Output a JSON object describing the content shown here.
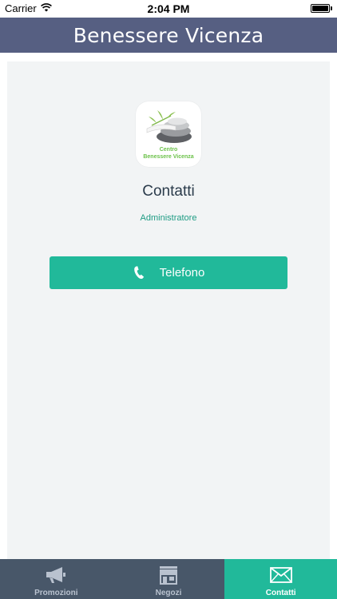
{
  "status_bar": {
    "carrier": "Carrier",
    "time": "2:04 PM"
  },
  "nav": {
    "title": "Benessere Vicenza"
  },
  "contact": {
    "logo": {
      "line1": "Centro",
      "line2": "Benessere Vicenza"
    },
    "title": "Contatti",
    "role": "Administratore",
    "phone_button_label": "Telefono"
  },
  "tabs": [
    {
      "label": "Promozioni",
      "icon": "megaphone-icon",
      "active": false
    },
    {
      "label": "Negozi",
      "icon": "store-icon",
      "active": false
    },
    {
      "label": "Contatti",
      "icon": "envelope-icon",
      "active": true
    }
  ],
  "colors": {
    "nav_bar": "#565f82",
    "accent": "#21b99a",
    "tab_bar": "#485769",
    "content_bg": "#f2f4f5"
  }
}
